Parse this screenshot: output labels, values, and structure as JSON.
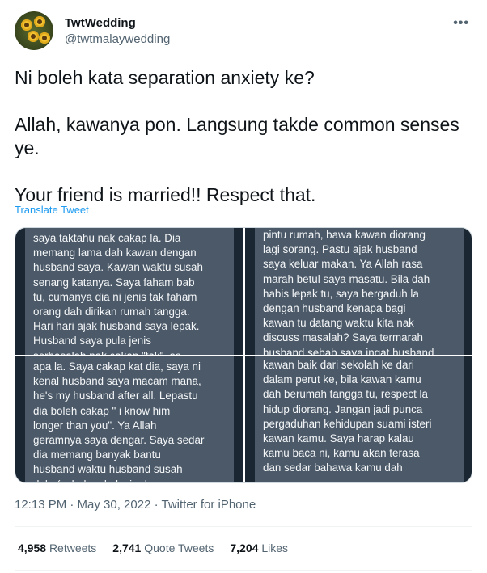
{
  "author": {
    "name": "TwtWedding",
    "handle": "@twtmalaywedding",
    "avatar_icon": "sunflower-avatar-icon",
    "more_icon": "more-horizontal-icon"
  },
  "tweet": {
    "paragraphs": [
      "Ni boleh kata separation anxiety ke?",
      "Allah, kawanya pon. Langsung takde common senses ye.",
      "Your friend is married!! Respect that."
    ],
    "translate_label": "Translate Tweet"
  },
  "media": {
    "panels": [
      "saya taktahu nak cakap la. Dia\nmemang lama dah kawan dengan\nhusband saya. Kawan waktu susah\nsenang katanya. Saya faham bab\ntu, cumanya dia ni jenis tak faham\norang dah dirikan rumah tangga.\nHari hari ajak husband saya lepak.\nHusband saya pula jenis\nserbasalah nak cakap \"tak\", so",
      "pintu rumah, bawa kawan diorang\nlagi sorang. Pastu ajak husband\nsaya keluar makan. Ya Allah rasa\nmarah betul saya masatu. Bila dah\nhabis lepak tu, saya bergaduh la\ndengan husband kenapa bagi\nkawan tu datang waktu kita nak\ndiscuss masalah? Saya termarah\nhusband sebab saya ingat husband",
      "apa la. Saya cakap kat dia, saya ni\nkenal husband saya macam mana,\nhe's my husband after all. Lepastu\ndia boleh cakap \" i know him\nlonger than you\". Ya Allah\ngeramnya saya dengar. Saya sedar\ndia memang banyak bantu\nhusband waktu husband susah\ndulu (sebelum kahwin dengan",
      "kawan baik dari sekolah ke dari\ndalam perut ke, bila kawan kamu\ndah berumah tangga tu, respect la\nhidup diorang. Jangan jadi punca\npergaduhan kehidupan suami isteri\nkawan kamu. Saya harap kalau\nkamu baca ni, kamu akan terasa\ndan sedar bahawa kamu dah"
    ]
  },
  "meta": {
    "timestamp": "12:13 PM · May 30, 2022 · Twitter for iPhone"
  },
  "stats": {
    "retweets_count": "4,958",
    "retweets_label": "Retweets",
    "quotes_count": "2,741",
    "quotes_label": "Quote Tweets",
    "likes_count": "7,204",
    "likes_label": "Likes"
  },
  "colors": {
    "link": "#1d9bf0",
    "secondary_text": "#536471",
    "panel_bg": "#4b5968"
  }
}
